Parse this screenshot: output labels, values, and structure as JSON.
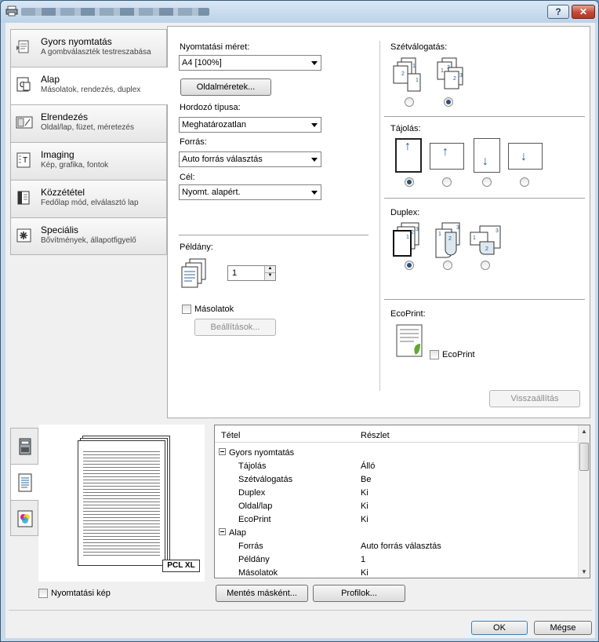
{
  "titlebar": {
    "help": "?",
    "close": "✕"
  },
  "nav": [
    {
      "title": "Gyors nyomtatás",
      "sub": "A gombválaszték testreszabása",
      "icon": "quick-print-icon"
    },
    {
      "title": "Alap",
      "sub": "Másolatok, rendezés, duplex",
      "icon": "basic-icon"
    },
    {
      "title": "Elrendezés",
      "sub": "Oldal/lap, füzet, méretezés",
      "icon": "layout-icon"
    },
    {
      "title": "Imaging",
      "sub": "Kép, grafika, fontok",
      "icon": "imaging-icon"
    },
    {
      "title": "Közzététel",
      "sub": "Fedőlap mód, elválasztó lap",
      "icon": "publishing-icon"
    },
    {
      "title": "Speciális",
      "sub": "Bővítmények, állapotfigyelő",
      "icon": "advanced-icon"
    }
  ],
  "basic": {
    "print_size_label": "Nyomtatási méret:",
    "print_size_value": "A4  [100%]",
    "page_sizes_button": "Oldalméretek...",
    "media_type_label": "Hordozó típusa:",
    "media_type_value": "Meghatározatlan",
    "source_label": "Forrás:",
    "source_value": "Auto forrás választás",
    "destination_label": "Cél:",
    "destination_value": "Nyomt. alapért.",
    "copies_label": "Példány:",
    "copies_value": "1",
    "copies_chk_label": "Másolatok",
    "settings_button": "Beállítások...",
    "collate_label": "Szétválogatás:",
    "orientation_label": "Tájolás:",
    "duplex_label": "Duplex:",
    "ecoprint_section": "EcoPrint:",
    "ecoprint_chk_label": "EcoPrint",
    "reset_button": "Visszaállítás"
  },
  "summary": {
    "col_item": "Tétel",
    "col_detail": "Részlet",
    "rows": [
      {
        "item": "Gyors nyomtatás",
        "detail": ""
      },
      {
        "item": "Tájolás",
        "detail": "Álló"
      },
      {
        "item": "Szétválogatás",
        "detail": "Be"
      },
      {
        "item": "Duplex",
        "detail": "Ki"
      },
      {
        "item": "Oldal/lap",
        "detail": "Ki"
      },
      {
        "item": "EcoPrint",
        "detail": "Ki"
      },
      {
        "item": "Alap",
        "detail": ""
      },
      {
        "item": "Forrás",
        "detail": "Auto forrás választás"
      },
      {
        "item": "Példány",
        "detail": "1"
      },
      {
        "item": "Másolatok",
        "detail": "Ki"
      }
    ]
  },
  "preview": {
    "badge": "PCL XL"
  },
  "footer": {
    "print_preview_label": "Nyomtatási kép",
    "save_as_button": "Mentés másként...",
    "profiles_button": "Profilok...",
    "ok_button": "OK",
    "cancel_button": "Mégse"
  }
}
